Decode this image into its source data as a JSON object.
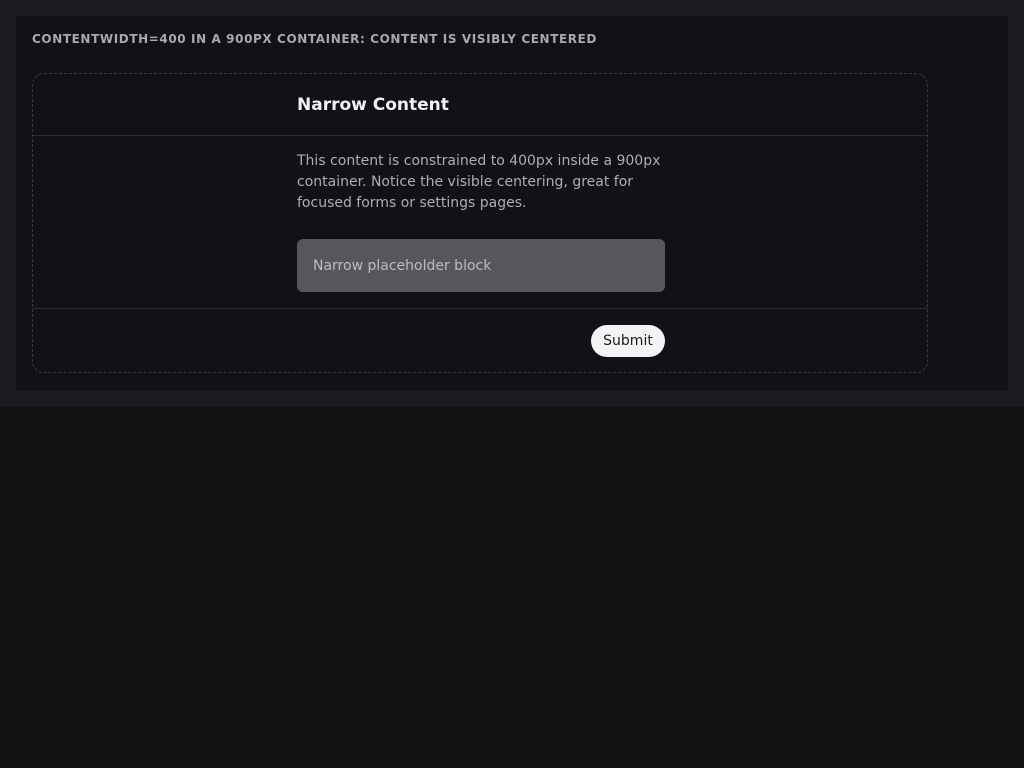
{
  "caption": "CONTENTWIDTH=400 IN A 900PX CONTAINER: CONTENT IS VISIBLY CENTERED",
  "card": {
    "title": "Narrow Content",
    "description": "This content is constrained to 400px inside a 900px container. Notice the visible centering, great for focused forms or settings pages.",
    "placeholder": "Narrow placeholder block",
    "submit_label": "Submit"
  }
}
